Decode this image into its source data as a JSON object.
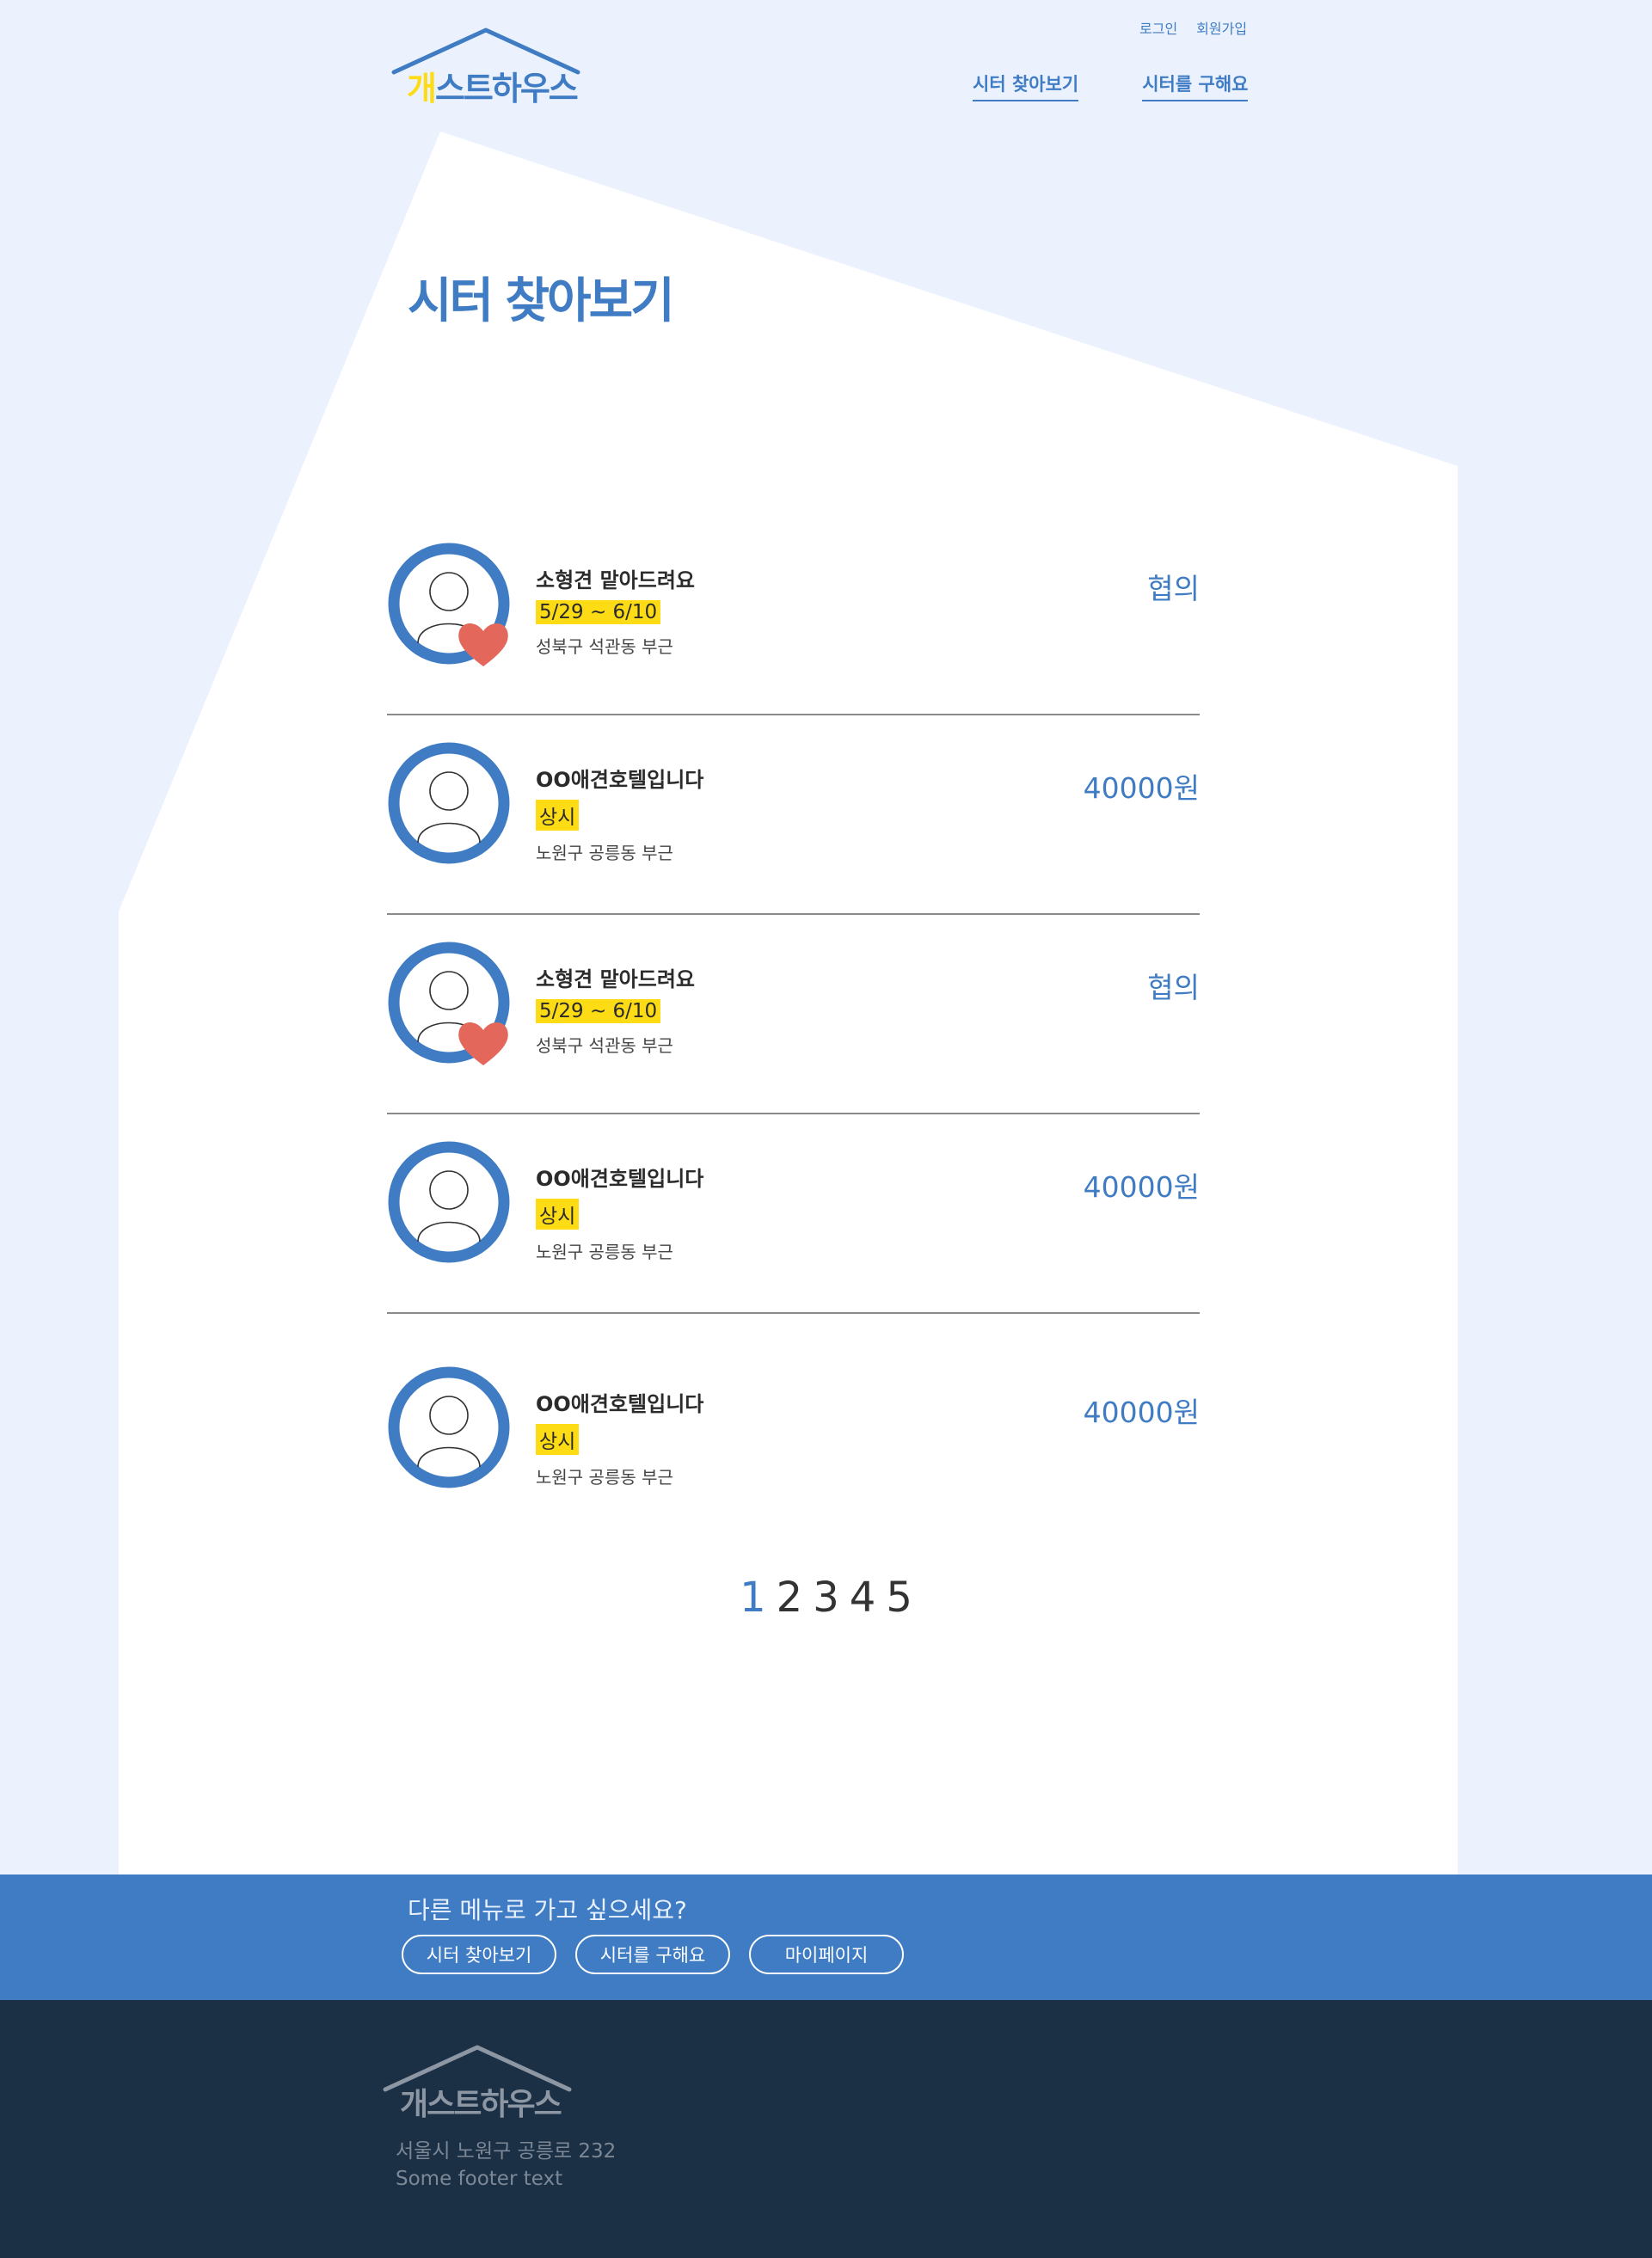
{
  "header": {
    "login": "로그인",
    "signup": "회원가입",
    "logo_first": "개",
    "logo_rest": "스트하우스",
    "nav": [
      "시터 찾아보기",
      "시터를 구해요"
    ]
  },
  "page_title": "시터 찾아보기",
  "listings": [
    {
      "name": "소형견 맡아드려요",
      "badge": "5/29 ~ 6/10",
      "location": "성북구 석관동 부근",
      "price": "협의",
      "heart": true
    },
    {
      "name": "OO애견호텔입니다",
      "badge": "상시",
      "location": "노원구 공릉동 부근",
      "price": "40000원",
      "heart": false
    },
    {
      "name": "소형견 맡아드려요",
      "badge": "5/29 ~ 6/10",
      "location": "성북구 석관동 부근",
      "price": "협의",
      "heart": true
    },
    {
      "name": "OO애견호텔입니다",
      "badge": "상시",
      "location": "노원구 공릉동 부근",
      "price": "40000원",
      "heart": false
    },
    {
      "name": "OO애견호텔입니다",
      "badge": "상시",
      "location": "노원구 공릉동 부근",
      "price": "40000원",
      "heart": false
    }
  ],
  "pagination": {
    "pages": [
      "1",
      "2",
      "3",
      "4",
      "5"
    ],
    "current": "1"
  },
  "menu_band": {
    "question": "다른 메뉴로 가고 싶으세요?",
    "buttons": [
      "시터 찾아보기",
      "시터를 구해요",
      "마이페이지"
    ]
  },
  "footer": {
    "logo": "개스트하우스",
    "address": "서울시 노원구 공릉로 232",
    "text": "Some footer text"
  },
  "colors": {
    "accent": "#3f7cc3",
    "highlight": "#fddc16",
    "heart": "#e3675a",
    "footer_bg": "#1b2f45",
    "page_bg": "#ebf2fe"
  }
}
